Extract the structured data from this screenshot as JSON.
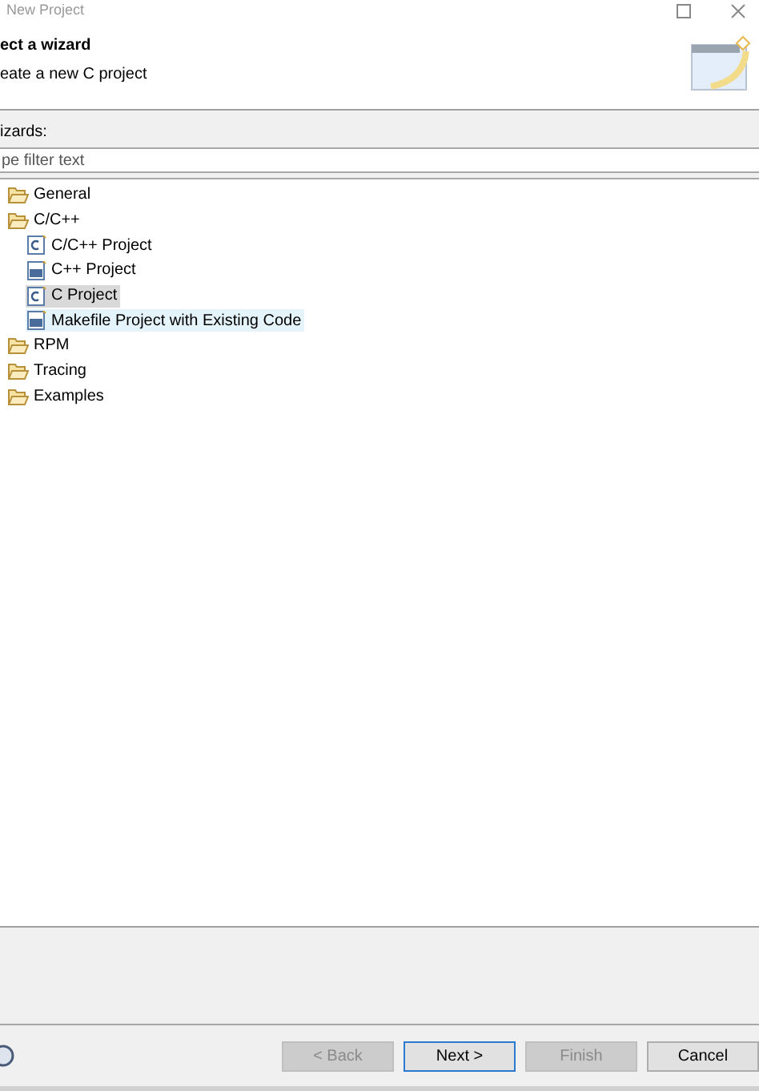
{
  "window": {
    "title": "New Project"
  },
  "header": {
    "title": "ect a wizard",
    "subtitle": "eate a new C project"
  },
  "filter": {
    "label": "izards:",
    "placeholder": "pe filter text"
  },
  "tree": [
    {
      "label": "General",
      "kind": "folder",
      "selected": false,
      "highlighted": false
    },
    {
      "label": "C/C++",
      "kind": "folder",
      "selected": false,
      "highlighted": false,
      "children": [
        {
          "label": "C/C++ Project",
          "kind": "c-project",
          "selected": false,
          "highlighted": false
        },
        {
          "label": "C++ Project",
          "kind": "cpp-project",
          "selected": false,
          "highlighted": false
        },
        {
          "label": "C Project",
          "kind": "c-project",
          "selected": true,
          "highlighted": false
        },
        {
          "label": "Makefile Project with Existing Code",
          "kind": "cpp-project",
          "selected": false,
          "highlighted": true
        }
      ]
    },
    {
      "label": "RPM",
      "kind": "folder",
      "selected": false,
      "highlighted": false
    },
    {
      "label": "Tracing",
      "kind": "folder",
      "selected": false,
      "highlighted": false
    },
    {
      "label": "Examples",
      "kind": "folder",
      "selected": false,
      "highlighted": false
    }
  ],
  "buttons": [
    {
      "label": "< Back",
      "disabled": true,
      "default": false
    },
    {
      "label": "Next >",
      "disabled": false,
      "default": true
    },
    {
      "label": "Finish",
      "disabled": true,
      "default": false
    },
    {
      "label": "Cancel",
      "disabled": false,
      "default": false
    }
  ]
}
